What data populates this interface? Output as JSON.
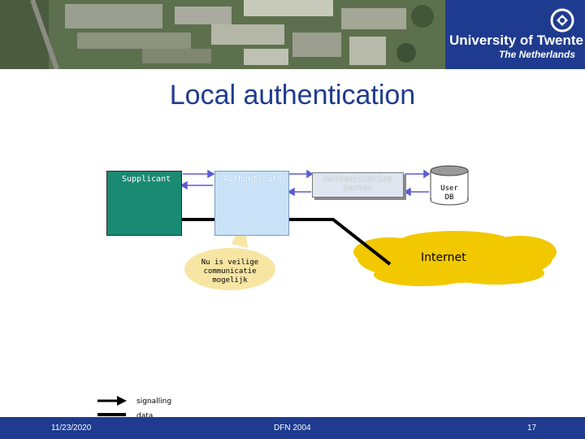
{
  "header": {
    "university_name": "University of Twente",
    "country": "The Netherlands"
  },
  "slide": {
    "title": "Local authentication"
  },
  "diagram": {
    "supplicant_label": "Supplicant",
    "authenticator_label": "Authenticator",
    "auth_server_label_line1": "Authentication",
    "auth_server_label_line2": "Server",
    "user_db_line1": "User",
    "user_db_line2": "DB",
    "internet_label": "Internet",
    "callout_line1": "Nu is veilige",
    "callout_line2": "communicatie",
    "callout_line3": "mogelijk"
  },
  "legend": {
    "signalling": "signalling",
    "data": "data"
  },
  "footer": {
    "date": "11/23/2020",
    "event": "DFN 2004",
    "page": "17"
  },
  "colors": {
    "brand_blue": "#1f3b8f",
    "supplicant_green": "#1a8a72",
    "authenticator_blue": "#c9e2f8",
    "internet_yellow": "#f2c800",
    "callout_cream": "#f7e6a3"
  }
}
